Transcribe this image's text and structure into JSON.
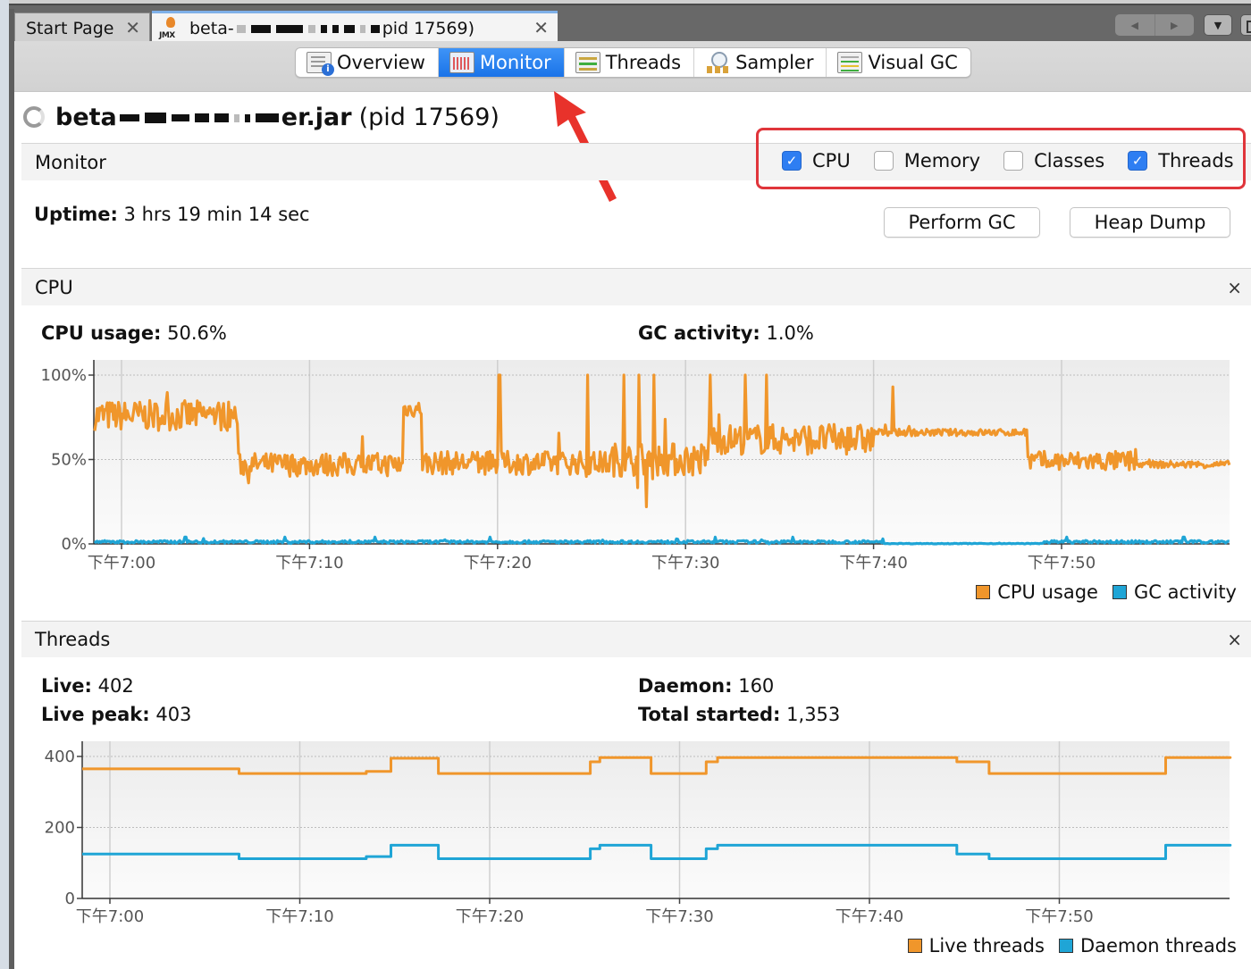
{
  "tabs": {
    "start_page": "Start Page",
    "active_tab_prefix": "beta-",
    "active_tab_suffix": "pid 17569)",
    "close_glyph": "✕"
  },
  "nav": {
    "left": "◀",
    "right": "▶",
    "dropdown": "▼"
  },
  "views": [
    {
      "label": "Overview",
      "icon": "overview-icon",
      "active": false
    },
    {
      "label": "Monitor",
      "icon": "monitor-icon",
      "active": true
    },
    {
      "label": "Threads",
      "icon": "threads-icon",
      "active": false
    },
    {
      "label": "Sampler",
      "icon": "sampler-icon",
      "active": false
    },
    {
      "label": "Visual GC",
      "icon": "visual-gc-icon",
      "active": false
    }
  ],
  "process": {
    "name_prefix": "beta",
    "name_suffix": "er.jar",
    "pid_text": "(pid 17569)"
  },
  "monitor": {
    "header": "Monitor",
    "checkboxes": [
      {
        "label": "CPU",
        "checked": true
      },
      {
        "label": "Memory",
        "checked": false
      },
      {
        "label": "Classes",
        "checked": false
      },
      {
        "label": "Threads",
        "checked": true
      }
    ],
    "uptime_label": "Uptime:",
    "uptime_value": "3 hrs 19 min 14 sec",
    "perform_gc": "Perform GC",
    "heap_dump": "Heap Dump"
  },
  "cpu": {
    "header": "CPU",
    "close": "×",
    "usage_label": "CPU usage:",
    "usage_value": "50.6%",
    "gc_label": "GC activity:",
    "gc_value": "1.0%"
  },
  "threads": {
    "header": "Threads",
    "close": "×",
    "live_label": "Live:",
    "live_value": "402",
    "peak_label": "Live peak:",
    "peak_value": "403",
    "daemon_label": "Daemon:",
    "daemon_value": "160",
    "total_label": "Total started:",
    "total_value": "1,353"
  },
  "colors": {
    "series_orange": "#f0962b",
    "series_blue": "#1fa5d6",
    "active_view": "#1a73e8",
    "annotation_red": "#e0353b"
  },
  "chart_data": [
    {
      "type": "line",
      "title": "CPU",
      "x_unit": "minutes after 7:00 PM",
      "xlim": [
        -1.5,
        59
      ],
      "ylim": [
        0,
        100
      ],
      "x_ticks": [
        0,
        10,
        20,
        30,
        40,
        50
      ],
      "x_tick_labels": [
        "下午7:00",
        "下午7:10",
        "下午7:20",
        "下午7:30",
        "下午7:40",
        "下午7:50"
      ],
      "y_ticks": [
        0,
        50,
        100
      ],
      "y_tick_labels": [
        "0%",
        "50%",
        "100%"
      ],
      "grid": true,
      "legend": "bottom-right",
      "series": [
        {
          "name": "CPU usage",
          "color": "#f0962b",
          "segments": [
            {
              "from": -1.5,
              "to": 6.2,
              "level": 76,
              "noise": 9
            },
            {
              "from": 6.2,
              "to": 15.0,
              "level": 47,
              "noise": 7
            },
            {
              "from": 15.0,
              "to": 16.0,
              "level": 80,
              "noise": 5
            },
            {
              "from": 16.0,
              "to": 26.0,
              "level": 48,
              "noise": 7
            },
            {
              "from": 26.0,
              "to": 31.2,
              "level": 50,
              "noise": 10
            },
            {
              "from": 31.2,
              "to": 40.0,
              "level": 62,
              "noise": 9
            },
            {
              "from": 40.0,
              "to": 48.2,
              "level": 66,
              "noise": 2
            },
            {
              "from": 48.2,
              "to": 54.0,
              "level": 49,
              "noise": 6
            },
            {
              "from": 54.0,
              "to": 59.0,
              "level": 47,
              "noise": 2
            }
          ],
          "spikes": [
            [
              20.1,
              100
            ],
            [
              24.8,
              100
            ],
            [
              26.7,
              100
            ],
            [
              27.5,
              100
            ],
            [
              28.3,
              100
            ],
            [
              31.3,
              100
            ],
            [
              33.2,
              100
            ],
            [
              34.3,
              100
            ],
            [
              27.9,
              22
            ],
            [
              41.0,
              93
            ]
          ]
        },
        {
          "name": "GC activity",
          "color": "#1fa5d6",
          "segments": [
            {
              "from": -1.5,
              "to": 40.5,
              "level": 1.2,
              "noise": 0.8
            },
            {
              "from": 40.5,
              "to": 49.0,
              "level": 0.2,
              "noise": 0.2
            },
            {
              "from": 49.0,
              "to": 59.0,
              "level": 1.2,
              "noise": 0.8
            }
          ],
          "spikes": [
            [
              3.4,
              4
            ],
            [
              8.7,
              4
            ],
            [
              13.5,
              4
            ],
            [
              19.6,
              4
            ],
            [
              31.6,
              4
            ],
            [
              35.7,
              4
            ],
            [
              50.3,
              4
            ],
            [
              56.5,
              4
            ]
          ]
        }
      ]
    },
    {
      "type": "line",
      "title": "Threads",
      "x_unit": "minutes after 7:00 PM",
      "xlim": [
        -1.5,
        59
      ],
      "ylim": [
        0,
        450
      ],
      "x_ticks": [
        0,
        10,
        20,
        30,
        40,
        50
      ],
      "x_tick_labels": [
        "下午7:00",
        "下午7:10",
        "下午7:20",
        "下午7:30",
        "下午7:40",
        "下午7:50"
      ],
      "y_ticks": [
        0,
        200,
        400
      ],
      "y_tick_labels": [
        "0",
        "200",
        "400"
      ],
      "grid": true,
      "legend": "bottom-right",
      "series": [
        {
          "name": "Live threads",
          "color": "#f0962b",
          "steps": [
            [
              -1.5,
              365
            ],
            [
              6.8,
              352
            ],
            [
              13.5,
              358
            ],
            [
              14.8,
              395
            ],
            [
              17.3,
              352
            ],
            [
              25.3,
              385
            ],
            [
              25.8,
              397
            ],
            [
              28.5,
              352
            ],
            [
              31.4,
              385
            ],
            [
              32.0,
              397
            ],
            [
              44.6,
              385
            ],
            [
              46.3,
              352
            ],
            [
              55.6,
              397
            ],
            [
              59,
              397
            ]
          ]
        },
        {
          "name": "Daemon threads",
          "color": "#1fa5d6",
          "steps": [
            [
              -1.5,
              125
            ],
            [
              6.8,
              112
            ],
            [
              13.5,
              118
            ],
            [
              14.8,
              150
            ],
            [
              17.3,
              112
            ],
            [
              25.3,
              140
            ],
            [
              25.8,
              150
            ],
            [
              28.5,
              112
            ],
            [
              31.4,
              140
            ],
            [
              32.0,
              150
            ],
            [
              44.6,
              125
            ],
            [
              46.3,
              112
            ],
            [
              55.6,
              150
            ],
            [
              59,
              150
            ]
          ]
        }
      ]
    }
  ]
}
